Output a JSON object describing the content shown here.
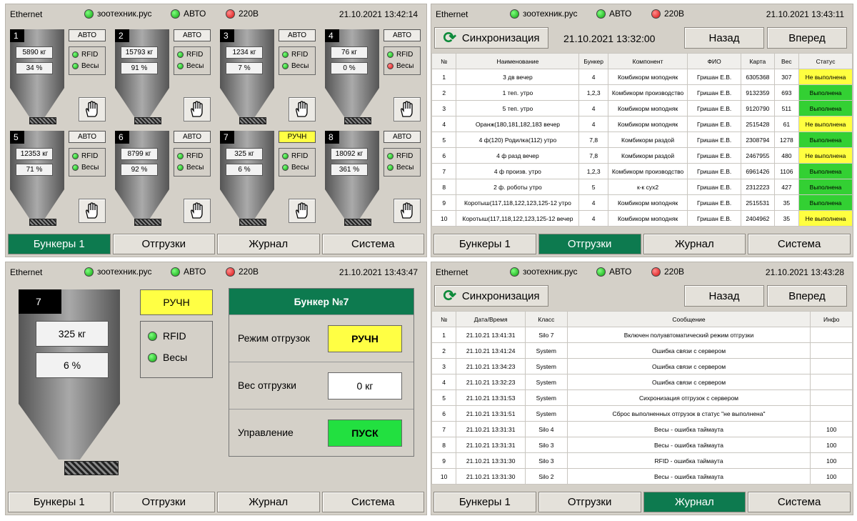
{
  "status": {
    "ethernet": "Ethernet",
    "server": "зоотехник.рус",
    "mode": "АВТО",
    "power": "220В"
  },
  "nav": [
    "Бункеры 1",
    "Отгрузки",
    "Журнал",
    "Система"
  ],
  "panel1": {
    "date": "21.10.2021 13:42:14",
    "bunkers": [
      {
        "num": "1",
        "weight": "5890 кг",
        "percent": "34 %",
        "mode": "АВТО",
        "rfid": "RFID",
        "scales": "Весы",
        "scales_state": "ok"
      },
      {
        "num": "2",
        "weight": "15793 кг",
        "percent": "91 %",
        "mode": "АВТО",
        "rfid": "RFID",
        "scales": "Весы",
        "scales_state": "ok"
      },
      {
        "num": "3",
        "weight": "1234 кг",
        "percent": "7 %",
        "mode": "АВТО",
        "rfid": "RFID",
        "scales": "Весы",
        "scales_state": "ok"
      },
      {
        "num": "4",
        "weight": "76 кг",
        "percent": "0 %",
        "mode": "АВТО",
        "rfid": "RFID",
        "scales": "Весы",
        "scales_state": "error"
      },
      {
        "num": "5",
        "weight": "12353 кг",
        "percent": "71 %",
        "mode": "АВТО",
        "rfid": "RFID",
        "scales": "Весы",
        "scales_state": "ok"
      },
      {
        "num": "6",
        "weight": "8799 кг",
        "percent": "92 %",
        "mode": "АВТО",
        "rfid": "RFID",
        "scales": "Весы",
        "scales_state": "ok"
      },
      {
        "num": "7",
        "weight": "325 кг",
        "percent": "6 %",
        "mode": "РУЧН",
        "rfid": "RFID",
        "scales": "Весы",
        "scales_state": "ok"
      },
      {
        "num": "8",
        "weight": "18092 кг",
        "percent": "361 %",
        "mode": "АВТО",
        "rfid": "RFID",
        "scales": "Весы",
        "scales_state": "ok"
      }
    ]
  },
  "panel2": {
    "date": "21.10.2021 13:43:11",
    "sync_label": "Синхронизация",
    "sync_time": "21.10.2021 13:32:00",
    "back": "Назад",
    "forward": "Вперед",
    "headers": [
      "№",
      "Наименование",
      "Бункер",
      "Компонент",
      "ФИО",
      "Карта",
      "Вес",
      "Статус"
    ],
    "rows": [
      [
        "1",
        "3 дв вечер",
        "4",
        "Комбикорм моподняк",
        "Гришан Е.В.",
        "6305368",
        "307",
        "Не выполнена"
      ],
      [
        "2",
        "1 теп. утро",
        "1,2,3",
        "Комбикорм производство",
        "Гришан Е.В.",
        "9132359",
        "693",
        "Выполнена"
      ],
      [
        "3",
        "5 теп. утро",
        "4",
        "Комбикорм моподняк",
        "Гришан Е.В.",
        "9120790",
        "511",
        "Выполнена"
      ],
      [
        "4",
        "Оранж(180,181,182,183 вечер",
        "4",
        "Комбикорм моподняк",
        "Гришан Е.В.",
        "2515428",
        "61",
        "Не выполнена"
      ],
      [
        "5",
        "4 ф(120) Родилка(112) утро",
        "7,8",
        "Комбикорм раздой",
        "Гришан Е.В.",
        "2308794",
        "1278",
        "Выполнена"
      ],
      [
        "6",
        "4 ф разд вечер",
        "7,8",
        "Комбикорм раздой",
        "Гришан Е.В.",
        "2467955",
        "480",
        "Не выполнена"
      ],
      [
        "7",
        "4 ф произв. утро",
        "1,2,3",
        "Комбикорм производство",
        "Гришан Е.В.",
        "6961426",
        "1106",
        "Выполнена"
      ],
      [
        "8",
        "2 ф. роботы утро",
        "5",
        "к-к сух2",
        "Гришан Е.В.",
        "2312223",
        "427",
        "Выполнена"
      ],
      [
        "9",
        "Коротыш(117,118,122,123,125-12 утро",
        "4",
        "Комбикорм моподняк",
        "Гришан Е.В.",
        "2515531",
        "35",
        "Выполнена"
      ],
      [
        "10",
        "Коротыш(117,118,122,123,125-12 вечер",
        "4",
        "Комбикорм моподняк",
        "Гришан Е.В.",
        "2404962",
        "35",
        "Не выполнена"
      ]
    ]
  },
  "panel3": {
    "date": "21.10.2021 13:43:47",
    "num": "7",
    "weight": "325 кг",
    "percent": "6 %",
    "mode": "РУЧН",
    "rfid": "RFID",
    "scales": "Весы",
    "title": "Бункер №7",
    "mode_label": "Режим отгрузок",
    "mode_value": "РУЧН",
    "weight_label": "Вес отгрузки",
    "weight_value": "0 кг",
    "control_label": "Управление",
    "control_value": "ПУСК"
  },
  "panel4": {
    "date": "21.10.2021 13:43:28",
    "sync_label": "Синхронизация",
    "back": "Назад",
    "forward": "Вперед",
    "headers": [
      "№",
      "Дата/Время",
      "Класс",
      "Сообщение",
      "Инфо"
    ],
    "rows": [
      [
        "1",
        "21.10.21 13:41:31",
        "Silo 7",
        "Включен полуавтоматический режим отгрузки",
        ""
      ],
      [
        "2",
        "21.10.21 13:41:24",
        "System",
        "Ошибка связи с сервером",
        ""
      ],
      [
        "3",
        "21.10.21 13:34:23",
        "System",
        "Ошибка связи с сервером",
        ""
      ],
      [
        "4",
        "21.10.21 13:32:23",
        "System",
        "Ошибка связи с сервером",
        ""
      ],
      [
        "5",
        "21.10.21 13:31:53",
        "System",
        "Сихронизация отгрузок с сервером",
        ""
      ],
      [
        "6",
        "21.10.21 13:31:51",
        "System",
        "Сброс выполненных отгрузок в статус \"не выполнена\"",
        ""
      ],
      [
        "7",
        "21.10.21 13:31:31",
        "Silo 4",
        "Весы - ошибка таймаута",
        "100"
      ],
      [
        "8",
        "21.10.21 13:31:31",
        "Silo 3",
        "Весы - ошибка таймаута",
        "100"
      ],
      [
        "9",
        "21.10.21 13:31:30",
        "Silo 3",
        "RFID - ошибка таймаута",
        "100"
      ],
      [
        "10",
        "21.10.21 13:31:30",
        "Silo 2",
        "Весы - ошибка таймаута",
        "100"
      ]
    ]
  },
  "colors": {
    "accent": "#0d7a4f",
    "ok": "#33d033",
    "warn": "#ffff40",
    "error": "#d81010"
  }
}
